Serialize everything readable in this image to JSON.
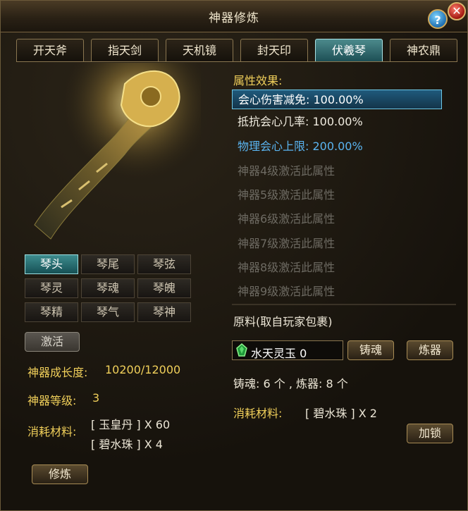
{
  "window": {
    "title": "神器修炼",
    "help_label": "?",
    "close_label": "✕"
  },
  "tabs": [
    {
      "label": "开天斧",
      "active": false
    },
    {
      "label": "指天剑",
      "active": false
    },
    {
      "label": "天机镜",
      "active": false
    },
    {
      "label": "封天印",
      "active": false
    },
    {
      "label": "伏羲琴",
      "active": true
    },
    {
      "label": "神农鼎",
      "active": false
    }
  ],
  "parts": [
    {
      "label": "琴头",
      "active": true
    },
    {
      "label": "琴尾",
      "active": false
    },
    {
      "label": "琴弦",
      "active": false
    },
    {
      "label": "琴灵",
      "active": false
    },
    {
      "label": "琴魂",
      "active": false
    },
    {
      "label": "琴魄",
      "active": false
    },
    {
      "label": "琴精",
      "active": false
    },
    {
      "label": "琴气",
      "active": false
    },
    {
      "label": "琴神",
      "active": false
    }
  ],
  "left": {
    "activate_label": "激活",
    "growth_label": "神器成长度:",
    "growth_value": "10200/12000",
    "growth_progress": 0.85,
    "level_label": "神器等级:",
    "level_value": "3",
    "consume_label": "消耗材料:",
    "consume_items": [
      "[ 玉皇丹 ] X 60",
      "[ 碧水珠 ] X 4"
    ],
    "refine_label": "修炼"
  },
  "attributes": {
    "title": "属性效果:",
    "rows": [
      {
        "text": "会心伤害减免: 100.00%",
        "style": "selected"
      },
      {
        "text": "抵抗会心几率: 100.00%",
        "style": "white"
      },
      {
        "text": "物理会心上限: 200.00%",
        "style": "blue"
      },
      {
        "text": "神器4级激活此属性",
        "style": "gray"
      },
      {
        "text": "神器5级激活此属性",
        "style": "gray"
      },
      {
        "text": "神器6级激活此属性",
        "style": "gray"
      },
      {
        "text": "神器7级激活此属性",
        "style": "gray"
      },
      {
        "text": "神器8级激活此属性",
        "style": "gray"
      },
      {
        "text": "神器9级激活此属性",
        "style": "gray"
      }
    ]
  },
  "materials": {
    "title": "原料(取自玩家包裹)",
    "item_text": "水天灵玉 0",
    "cast_label": "铸魂",
    "smelt_label": "炼器",
    "count_text": "铸魂: 6 个 , 炼器: 8 个",
    "consume_label": "消耗材料:",
    "consume_item": "[ 碧水珠 ] X 2",
    "lock_label": "加锁"
  },
  "colors": {
    "gold_label": "#f0cf5a",
    "active_tab": "#2f7478",
    "attr_blue": "#5ab4f0",
    "attr_gray": "#6d6a62"
  }
}
